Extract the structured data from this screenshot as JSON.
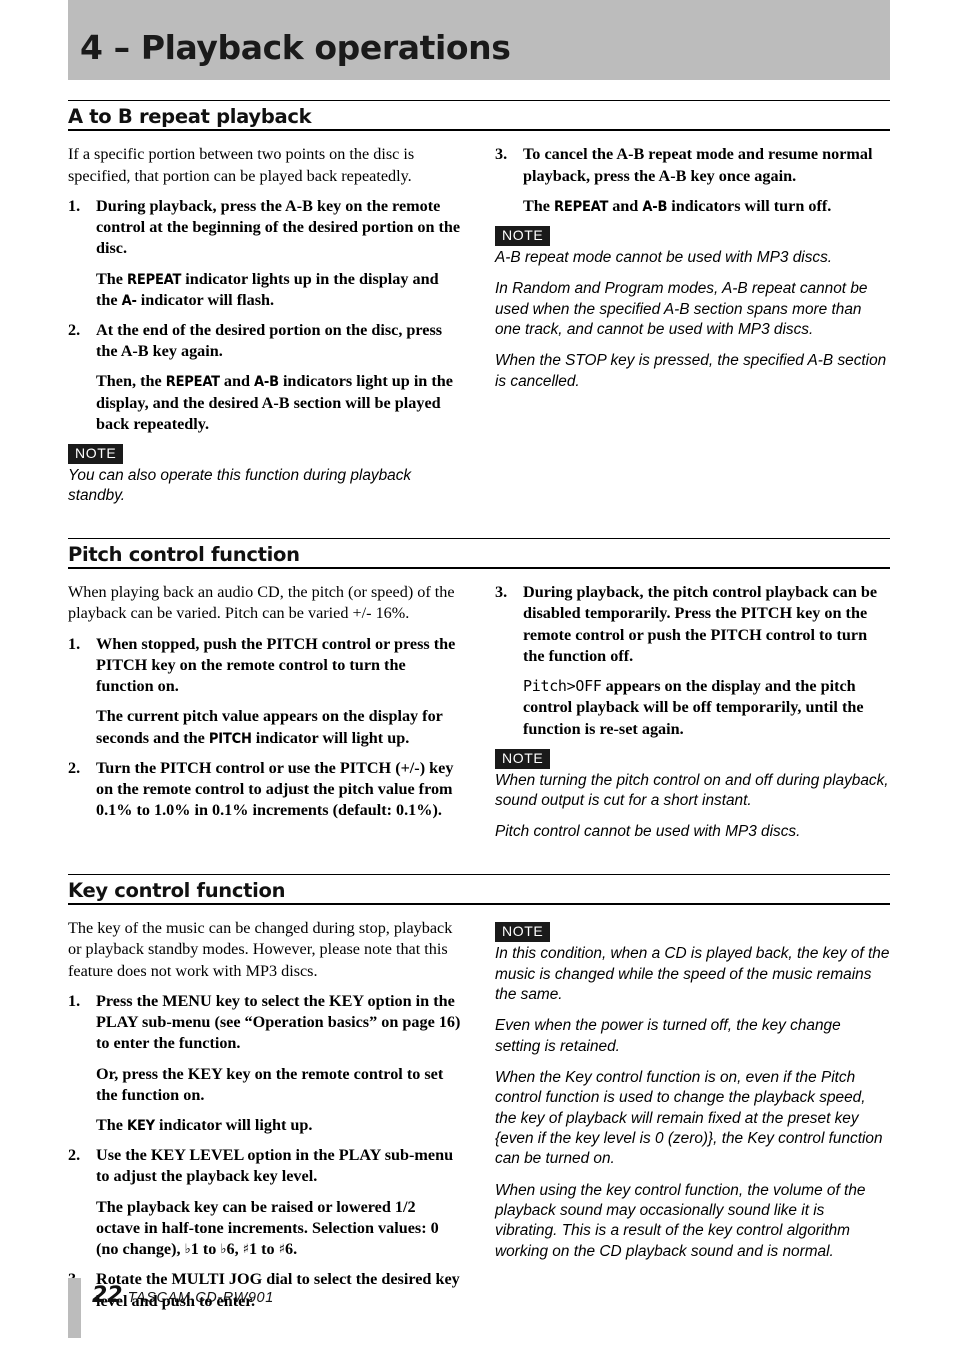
{
  "chapter": {
    "title": "4 – Playback operations"
  },
  "sections": [
    {
      "heading": "A to B repeat playback",
      "left": {
        "intro": "If a specific portion between two points on the disc is specified, that portion can be played back repeatedly.",
        "step1_num": "1.",
        "step1_text": "During playback, press the A-B key on the remote control at the beginning of the desired portion on the disc.",
        "step1_sub_pre": "The ",
        "step1_sub_ind1": "REPEAT",
        "step1_sub_mid": " indicator lights up in the display and the ",
        "step1_sub_ind2": "A-",
        "step1_sub_post": " indicator will flash.",
        "step2_num": "2.",
        "step2_text": "At the end of the desired portion on the disc, press the A-B key again.",
        "step2_sub_pre": "Then, the ",
        "step2_sub_ind1": "REPEAT",
        "step2_sub_mid": " and ",
        "step2_sub_ind2": "A-B",
        "step2_sub_post": " indicators light up in the display, and the desired A-B section will be played back repeatedly.",
        "note_badge": "NOTE",
        "note1": "You can also operate this function during playback standby."
      },
      "right": {
        "step3_num": "3.",
        "step3_text": "To cancel the A-B repeat mode and resume normal playback, press the A-B key once again.",
        "step3_sub_pre": "The ",
        "step3_sub_ind1": "REPEAT",
        "step3_sub_mid": " and ",
        "step3_sub_ind2": "A-B",
        "step3_sub_post": " indicators will turn off.",
        "note_badge": "NOTE",
        "note1": "A-B repeat mode cannot be used with MP3 discs.",
        "note2": "In Random and Program modes, A-B repeat cannot be used when the specified A-B section spans more than one track, and cannot be used with MP3 discs.",
        "note3": "When the STOP key is pressed, the specified A-B section is cancelled."
      }
    },
    {
      "heading": "Pitch control function",
      "left": {
        "intro": "When playing back an audio CD, the pitch (or speed) of the playback can be varied. Pitch can be varied +/- 16%.",
        "step1_num": "1.",
        "step1_text": "When stopped, push the PITCH control or press the PITCH key on the remote control to turn the function on.",
        "step1_sub_pre": "The current pitch value appears on the display for seconds and the ",
        "step1_sub_ind1": "PITCH",
        "step1_sub_post": " indicator will light up.",
        "step2_num": "2.",
        "step2_text": "Turn the PITCH control or use the PITCH (+/-) key on the remote control to adjust the pitch value from 0.1% to 1.0% in 0.1% increments (default: 0.1%)."
      },
      "right": {
        "step3_num": "3.",
        "step3_text": "During playback, the pitch control playback can be disabled temporarily. Press the PITCH key on the remote control or push the PITCH control to turn the function off.",
        "step3_sub_mono": "Pitch>OFF",
        "step3_sub_post": " appears on the display and the pitch control playback will be off temporarily, until the function is re-set again.",
        "note_badge": "NOTE",
        "note1": "When turning the pitch control on and off during playback, sound output is cut for a short instant.",
        "note2": "Pitch control cannot be used with MP3 discs."
      }
    },
    {
      "heading": "Key control function",
      "left": {
        "intro": "The key of the music can be changed during stop, playback or playback standby modes. However, please note that this feature does not work with MP3 discs.",
        "step1_num": "1.",
        "step1_text": "Press the MENU key to select the KEY option in the PLAY sub-menu (see “Operation basics” on page 16) to enter the function.",
        "step1_sub1": "Or, press the KEY key on the remote control to set the function on.",
        "step1_sub2_pre": "The ",
        "step1_sub2_ind": "KEY",
        "step1_sub2_post": " indicator will light up.",
        "step2_num": "2.",
        "step2_text": "Use the KEY LEVEL option in the PLAY sub-menu to adjust the playback key level.",
        "step2_sub_pre": "The playback key can be raised or lowered 1/2 octave in half-tone increments. Selection values: 0 (no change), ",
        "step2_sub_flat1": "♭",
        "step2_sub_v1": "1",
        "step2_sub_to1": " to ",
        "step2_sub_flat2": "♭",
        "step2_sub_v2": "6",
        "step2_sub_comma": ", ",
        "step2_sub_sharp1": "♯",
        "step2_sub_v3": "1",
        "step2_sub_to2": " to ",
        "step2_sub_sharp2": "♯",
        "step2_sub_v4": "6",
        "step2_sub_period": ".",
        "step3_num": "3.",
        "step3_text": "Rotate the MULTI JOG dial to select the desired key level and push to enter."
      },
      "right": {
        "note_badge": "NOTE",
        "note1": "In this condition, when a CD is played back, the key of the music is changed while the speed of the music remains the same.",
        "note2": "Even when the power is turned off, the key change setting is retained.",
        "note3": "When the Key control function is on, even if the Pitch control function is used to change the playback speed, the key of playback will remain fixed at the preset key {even if the key level is 0 (zero)}, the Key control function can be turned on.",
        "note4": "When using the key control function, the volume of the playback sound may occasionally sound like it is vibrating. This is a result of the key control algorithm working on the CD playback sound and is normal."
      }
    }
  ],
  "footer": {
    "page_number": "22",
    "model": "TASCAM  CD-RW901"
  },
  "colors": {
    "band_gray": "#bcbcbc",
    "text_black": "#000000",
    "note_badge_bg": "#1a1a1a"
  }
}
